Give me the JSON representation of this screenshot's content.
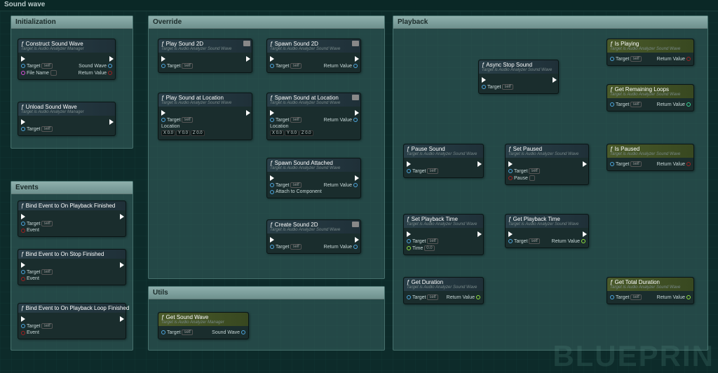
{
  "title": "Sound wave",
  "watermark": "BLUEPRIN",
  "groups": {
    "init": "Initialization",
    "events": "Events",
    "override": "Override",
    "utils": "Utils",
    "playback": "Playback"
  },
  "subtitle_wave": "Target is Audio Analyzer Sound Wave",
  "subtitle_mgr": "Target is Audio Analyzer Manager",
  "pins": {
    "target": "Target",
    "self": "self",
    "filename": "File Name",
    "soundwave": "Sound Wave",
    "returnvalue": "Return Value",
    "event": "Event",
    "location": "Location",
    "attach": "Attach to Component",
    "time": "Time",
    "pause": "Pause"
  },
  "vec": {
    "x": "X 0.0",
    "y": "Y 0.0",
    "z": "Z 0.0"
  },
  "timeval": "0.0",
  "nodes": {
    "construct": "Construct Sound Wave",
    "unload": "Unload Sound Wave",
    "bind_pf": "Bind Event to On Playback Finished",
    "bind_sf": "Bind Event to On Stop Finished",
    "bind_plf": "Bind Event to On Playback Loop Finished",
    "play2d": "Play Sound 2D",
    "playloc": "Play Sound at Location",
    "spawn2d": "Spawn Sound 2D",
    "spawnloc": "Spawn Sound at Location",
    "spawnatt": "Spawn Sound Attached",
    "create2d": "Create Sound 2D",
    "getsw": "Get Sound Wave",
    "asyncstop": "Async Stop Sound",
    "pausesnd": "Pause Sound",
    "setpaused": "Set Paused",
    "setpbt": "Set Playback Time",
    "getpbt": "Get Playback Time",
    "getdur": "Get Duration",
    "isplay": "Is Playing",
    "getrl": "Get Remaining Loops",
    "ispaused": "Is Paused",
    "gettd": "Get Total Duration"
  }
}
